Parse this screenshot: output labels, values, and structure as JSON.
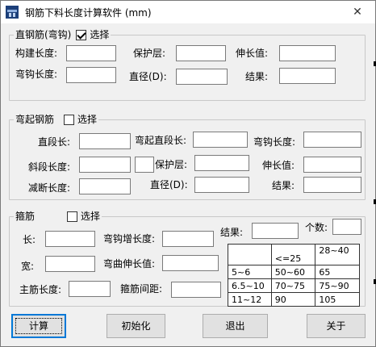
{
  "window": {
    "title": "钢筋下料长度计算软件  (mm)",
    "close_glyph": "✕"
  },
  "straight": {
    "legend": "直钢筋(弯钩)",
    "select_label": "选择",
    "checked": true,
    "member_length": "构建长度:",
    "cover": "保护层:",
    "elongation": "伸长值:",
    "hook_length": "弯钩长度:",
    "diameter": "直径(D):",
    "result": "结果:"
  },
  "bent": {
    "legend": "弯起钢筋",
    "select_label": "选择",
    "checked": false,
    "straight_length": "直段长:",
    "bent_straight_length": "弯起直段长:",
    "hook_length": "弯钩长度:",
    "slant_length": "斜段长度:",
    "cover": "保护层:",
    "elongation": "伸长值:",
    "reduce_length": "减断长度:",
    "diameter": "直径(D):",
    "result": "结果:"
  },
  "stirrup": {
    "legend": "箍筋",
    "select_label": "选择",
    "checked": false,
    "length": "长:",
    "hook_add": "弯钩增长度:",
    "result": "结果:",
    "count": "个数:",
    "width": "宽:",
    "bend_elongation": "弯曲伸长值:",
    "main_bar_length": "主筋长度:",
    "spacing": "箍筋间距:",
    "table": [
      [
        "",
        "<=25",
        "28~40"
      ],
      [
        "5~6",
        "50~60",
        "65"
      ],
      [
        "6.5~10",
        "70~75",
        "75~90"
      ],
      [
        "11~12",
        "90",
        "105"
      ]
    ]
  },
  "buttons": {
    "calc": "计算",
    "init": "初始化",
    "exit": "退出",
    "about": "关于"
  }
}
